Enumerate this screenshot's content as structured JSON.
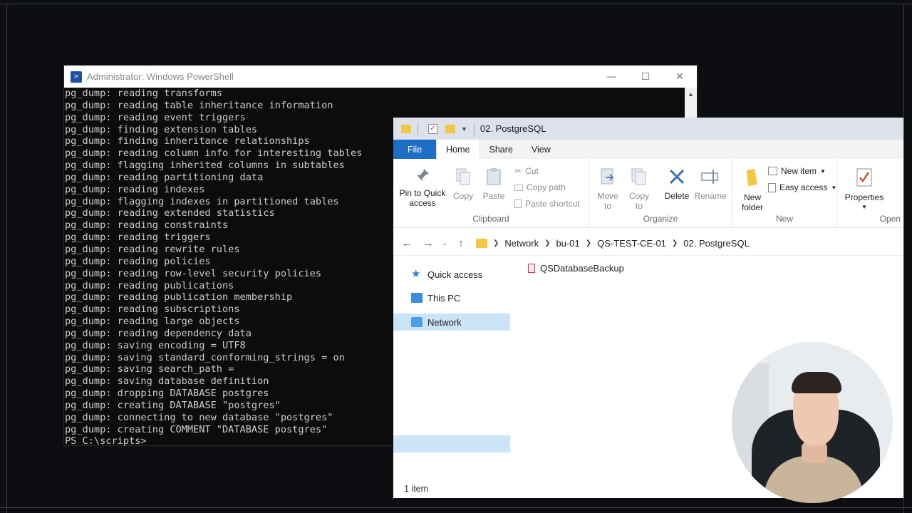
{
  "powershell": {
    "title": "Administrator: Windows PowerShell",
    "lines": [
      "pg_dump: reading transforms",
      "pg_dump: reading table inheritance information",
      "pg_dump: reading event triggers",
      "pg_dump: finding extension tables",
      "pg_dump: finding inheritance relationships",
      "pg_dump: reading column info for interesting tables",
      "pg_dump: flagging inherited columns in subtables",
      "pg_dump: reading partitioning data",
      "pg_dump: reading indexes",
      "pg_dump: flagging indexes in partitioned tables",
      "pg_dump: reading extended statistics",
      "pg_dump: reading constraints",
      "pg_dump: reading triggers",
      "pg_dump: reading rewrite rules",
      "pg_dump: reading policies",
      "pg_dump: reading row-level security policies",
      "pg_dump: reading publications",
      "pg_dump: reading publication membership",
      "pg_dump: reading subscriptions",
      "pg_dump: reading large objects",
      "pg_dump: reading dependency data",
      "pg_dump: saving encoding = UTF8",
      "pg_dump: saving standard_conforming_strings = on",
      "pg_dump: saving search_path =",
      "pg_dump: saving database definition",
      "pg_dump: dropping DATABASE postgres",
      "pg_dump: creating DATABASE \"postgres\"",
      "pg_dump: connecting to new database \"postgres\"",
      "pg_dump: creating COMMENT \"DATABASE postgres\"",
      "PS C:\\scripts>"
    ]
  },
  "explorer": {
    "title": "02. PostgreSQL",
    "tabs": [
      "File",
      "Home",
      "Share",
      "View"
    ],
    "ribbon": {
      "pin": "Pin to Quick access",
      "copy": "Copy",
      "paste": "Paste",
      "cut": "Cut",
      "copy_path": "Copy path",
      "paste_shortcut": "Paste shortcut",
      "clipboard": "Clipboard",
      "move_to": "Move to",
      "copy_to": "Copy to",
      "delete": "Delete",
      "rename": "Rename",
      "organize": "Organize",
      "new_folder": "New folder",
      "new_item": "New item",
      "easy_access": "Easy access",
      "new": "New",
      "properties": "Properties",
      "open": "Open"
    },
    "breadcrumb": [
      "Network",
      "bu-01",
      "QS-TEST-CE-01",
      "02. PostgreSQL"
    ],
    "nav": [
      "Quick access",
      "This PC",
      "Network"
    ],
    "files": [
      "QSDatabaseBackup"
    ],
    "status": "1 item"
  },
  "colors": {
    "file_tab": "#1f6ec6",
    "selection": "#cce4f7",
    "folder": "#f3c644"
  }
}
